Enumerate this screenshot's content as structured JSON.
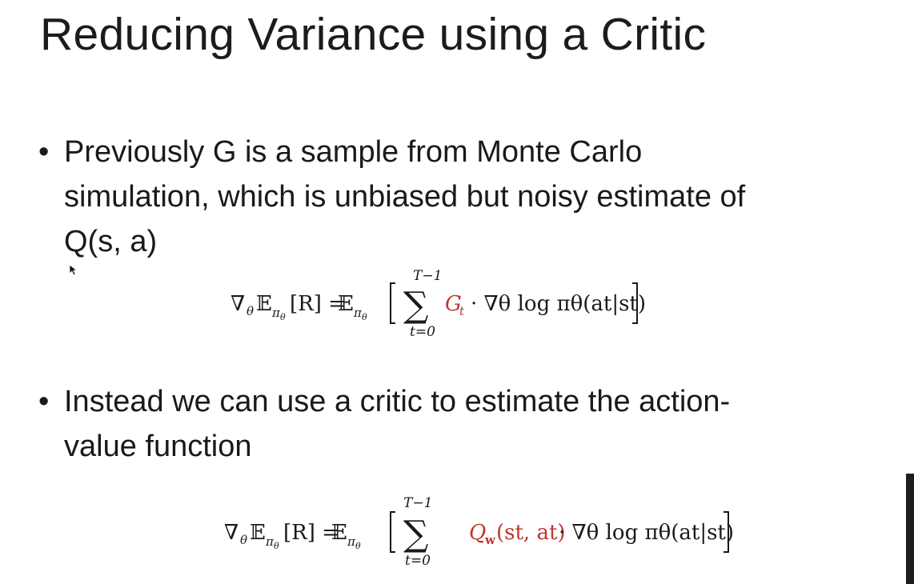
{
  "slide": {
    "title": "Reducing Variance using a Critic",
    "bullets": [
      {
        "lines": [
          "Previously G is a sample from Monte Carlo",
          "simulation, which is unbiased but noisy estimate of",
          "Q(s, a)"
        ]
      },
      {
        "lines": [
          "Instead we can use a critic to estimate the action-",
          "value function"
        ]
      }
    ],
    "bullet_glyph": "•",
    "equations": [
      {
        "lhs_nabla": "∇",
        "lhs_theta": "θ",
        "expect": "𝔼",
        "pi_sub": "π",
        "theta_sub": "θ",
        "R_bracket": "[R] =",
        "sum_upper": "T−1",
        "sum_lower": "t=0",
        "sum": "∑",
        "weight": "G",
        "weight_sub": "t",
        "rest": "· ∇θ log πθ(at|st)"
      },
      {
        "lhs_nabla": "∇",
        "lhs_theta": "θ",
        "expect": "𝔼",
        "pi_sub": "π",
        "theta_sub": "θ",
        "R_bracket": "[R] =",
        "sum_upper": "T−1",
        "sum_lower": "t=0",
        "sum": "∑",
        "weight": "Q",
        "weight_sub": "w",
        "weight_args": "(st, at)",
        "rest": "· ∇θ log πθ(at|st)"
      }
    ],
    "colors": {
      "highlight": "#c0362c",
      "text": "#1a1a1a"
    }
  }
}
